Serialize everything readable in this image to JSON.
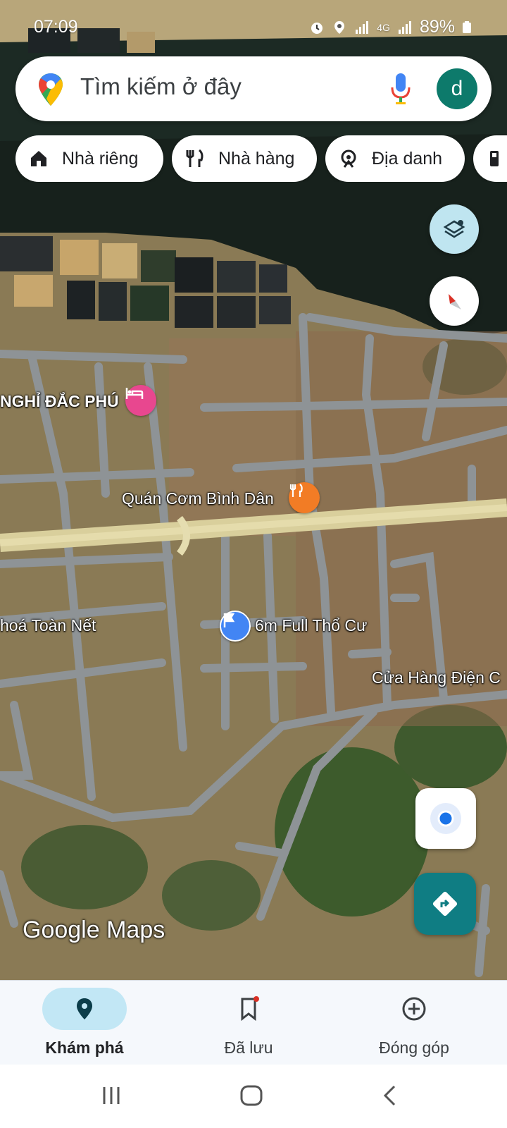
{
  "status_bar": {
    "time": "07:09",
    "network": "4G",
    "battery": "89%"
  },
  "search": {
    "placeholder": "Tìm kiếm ở đây",
    "account_initial": "d"
  },
  "chips": [
    {
      "label": "Nhà riêng",
      "icon": "home-icon"
    },
    {
      "label": "Nhà hàng",
      "icon": "restaurant-icon"
    },
    {
      "label": "Địa danh",
      "icon": "landmark-icon"
    }
  ],
  "map_labels": {
    "hotel": "NGHỈ ĐẮC PHÚ",
    "restaurant": "Quán Cơm Bình Dân",
    "shop": "hoá Toàn Nết",
    "parking": "6m Full Thổ Cư",
    "store": "Cửa Hàng Điện C"
  },
  "watermark": "Google Maps",
  "bottom_nav": [
    {
      "label": "Khám phá",
      "icon": "explore-pin-icon",
      "active": true
    },
    {
      "label": "Đã lưu",
      "icon": "bookmark-icon",
      "active": false
    },
    {
      "label": "Đóng góp",
      "icon": "add-circle-icon",
      "active": false
    }
  ],
  "colors": {
    "accent": "#0d7a6b",
    "nav_active": "#c2e7f5",
    "directions_fab": "#0f7d83"
  }
}
